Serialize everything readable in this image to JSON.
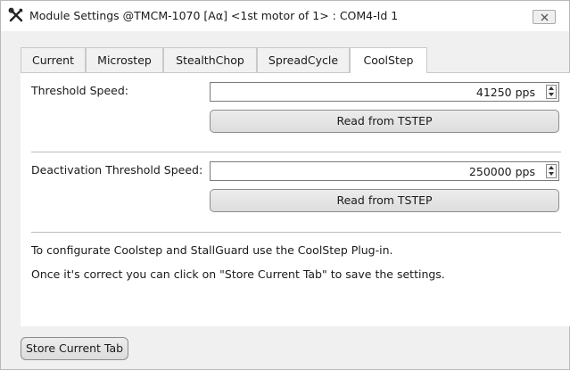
{
  "window": {
    "title": "Module Settings @TMCM-1070 [Aα] <1st motor of 1> : COM4-Id 1",
    "icon": "tools-icon",
    "close_icon": "close-icon"
  },
  "tabs": [
    {
      "label": "Current",
      "active": false
    },
    {
      "label": "Microstep",
      "active": false
    },
    {
      "label": "StealthChop",
      "active": false
    },
    {
      "label": "SpreadCycle",
      "active": false
    },
    {
      "label": "CoolStep",
      "active": true
    }
  ],
  "coolstep": {
    "threshold_speed": {
      "label": "Threshold Speed:",
      "value": "41250 pps",
      "read_button": "Read from TSTEP"
    },
    "deactivation_threshold_speed": {
      "label": "Deactivation Threshold Speed:",
      "value": "250000 pps",
      "read_button": "Read from TSTEP"
    },
    "info_line_1": "To configurate Coolstep and StallGuard use the CoolStep Plug-in.",
    "info_line_2": "Once it's correct you can click on \"Store Current Tab\" to save the settings."
  },
  "footer": {
    "store_button": "Store Current Tab"
  }
}
